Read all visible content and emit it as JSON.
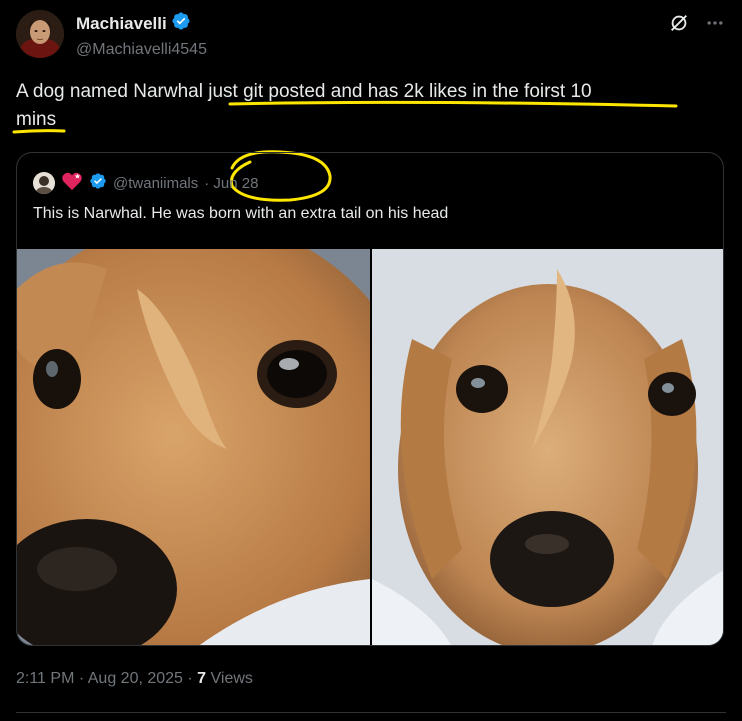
{
  "author": {
    "display_name": "Machiavelli",
    "handle": "@Machiavelli4545",
    "verified": true
  },
  "tweet": {
    "text_part1": "A dog named Narwhal ",
    "text_highlight": "just git posted and has 2k likes in the foirst 10",
    "text_line2": "mins",
    "annotation_color": "#ffe600"
  },
  "quote": {
    "handle": "@twaniimals",
    "separator": " · ",
    "date": "Jun 28",
    "text": "This is Narwhal. He was born with an extra tail on his head",
    "images": [
      "narwhal-puppy-closeup",
      "narwhal-puppy-front"
    ]
  },
  "meta": {
    "time": "2:11 PM",
    "dot": " · ",
    "date": "Aug 20, 2025",
    "views_count": "7",
    "views_label": " Views"
  },
  "colors": {
    "background": "#000000",
    "text": "#e7e9ea",
    "muted": "#71767b",
    "border": "#2f3336",
    "verified": "#1d9bf0"
  }
}
